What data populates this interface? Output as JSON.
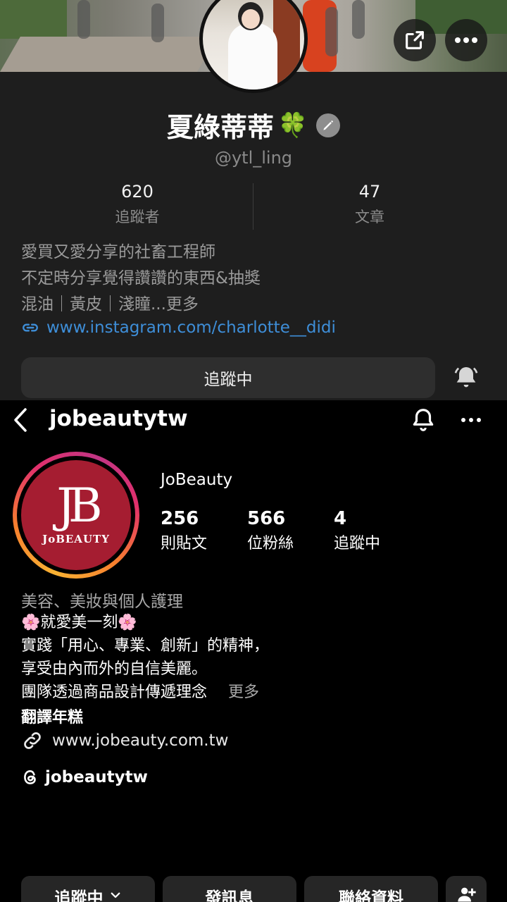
{
  "threads_profile": {
    "display_name": "夏綠蒂蒂",
    "handle": "@ytl_ling",
    "stats": [
      {
        "value": "620",
        "label": "追蹤者"
      },
      {
        "value": "47",
        "label": "文章"
      }
    ],
    "bio_lines": [
      "愛買又愛分享的社畜工程師",
      "不定時分享覺得讚讚的東西&抽獎",
      "混油｜黃皮｜淺瞳...更多"
    ],
    "link": "www.instagram.com/charlotte__didi",
    "follow_button": "追蹤中"
  },
  "instagram_profile": {
    "username": "jobeautytw",
    "logo_text": "JB",
    "logo_name": "JoBEAUTY",
    "name": "JoBeauty",
    "stats": [
      {
        "value": "256",
        "label": "則貼文"
      },
      {
        "value": "566",
        "label": "位粉絲"
      },
      {
        "value": "4",
        "label": "追蹤中"
      }
    ],
    "category": "美容、美妝與個人護理",
    "bio_lines": [
      "🌸就愛美一刻🌸",
      "實踐「用心、專業、創新」的精神，",
      "享受由內而外的自信美麗。",
      "團隊透過商品設計傳遞理念"
    ],
    "more_label": "更多",
    "translate_label": "翻譯年糕",
    "website": "www.jobeauty.com.tw",
    "threads_handle": "jobeautytw",
    "buttons": {
      "following": "追蹤中",
      "message": "發訊息",
      "contact": "聯絡資料"
    }
  },
  "colors": {
    "link_blue": "#3e8ed8",
    "logo_red": "#a51d31",
    "top_background": "#1e1e1e"
  }
}
